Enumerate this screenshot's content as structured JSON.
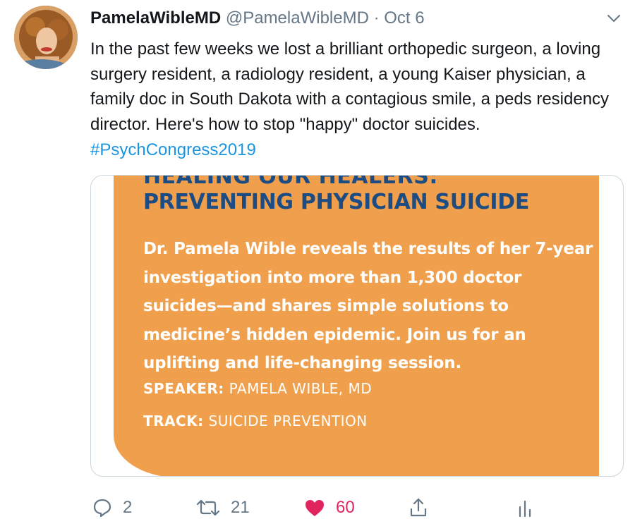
{
  "tweet": {
    "display_name": "PamelaWibleMD",
    "handle": "@PamelaWibleMD",
    "separator": "·",
    "date": "Oct 6",
    "text": "In the past few weeks we lost a brilliant orthopedic surgeon, a loving surgery resident, a radiology resident, a young Kaiser physician, a family doc in South Dakota with a contagious smile, a peds residency director. Here's how to stop \"happy\" doctor suicides. ",
    "hashtag": "#PsychCongress2019",
    "colors": {
      "hashtag": "#1b95e0",
      "like": "#e0245e",
      "muted": "#657786",
      "poster_bg": "#f0a04d",
      "poster_title": "#1d4c82"
    }
  },
  "media": {
    "top_cut_text": "HEALING OUR HEALERS:",
    "title": "PREVENTING PHYSICIAN SUICIDE",
    "description": "Dr. Pamela Wible reveals the results of her 7-year investigation into more than 1,300 doctor suicides—and shares simple solutions to medicine’s hidden epidemic. Join us for an uplifting and life-changing session.",
    "speaker_label": "SPEAKER:",
    "speaker_value": " PAMELA WIBLE, MD",
    "track_label": "TRACK:",
    "track_value": " SUICIDE PREVENTION"
  },
  "actions": {
    "reply": {
      "icon": "reply-icon",
      "count": "2"
    },
    "retweet": {
      "icon": "retweet-icon",
      "count": "21"
    },
    "like": {
      "icon": "heart-icon",
      "count": "60",
      "liked": true
    },
    "share": {
      "icon": "share-icon"
    },
    "analytics": {
      "icon": "analytics-icon"
    }
  },
  "header_controls": {
    "menu_icon": "chevron-down-icon"
  }
}
